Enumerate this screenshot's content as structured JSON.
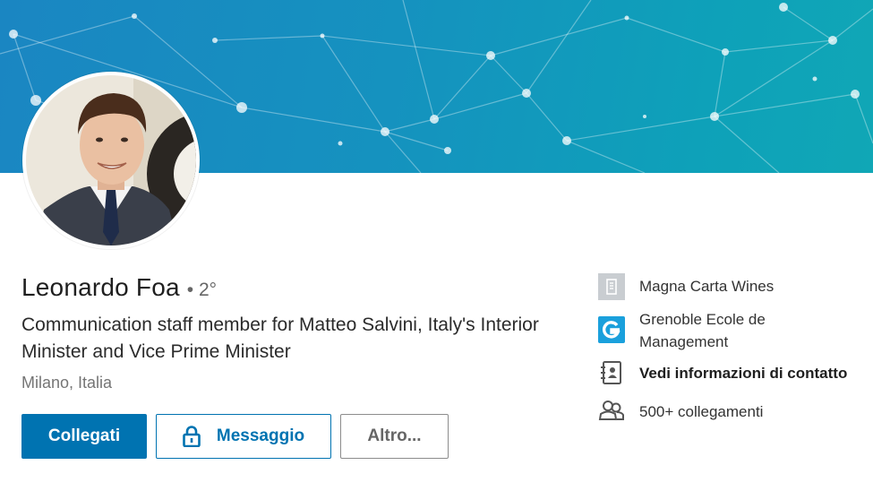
{
  "profile": {
    "name": "Leonardo Foa",
    "degree": "• 2°",
    "headline": "Communication staff member for Matteo Salvini, Italy's Interior Minister and Vice Prime Minister",
    "location": "Milano, Italia"
  },
  "actions": {
    "connect_label": "Collegati",
    "message_label": "Messaggio",
    "more_label": "Altro..."
  },
  "sidebar": {
    "company": "Magna Carta Wines",
    "school": "Grenoble Ecole de Management",
    "contact_info": "Vedi informazioni di contatto",
    "connections": "500+ collegamenti"
  },
  "icons": {
    "company": "building-icon",
    "school": "school-logo-icon",
    "contact": "address-book-icon",
    "connections": "people-icon",
    "message": "lock-icon"
  },
  "colors": {
    "primary": "#0073b1",
    "banner_start": "#1a86c2",
    "banner_end": "#10a7b6"
  }
}
